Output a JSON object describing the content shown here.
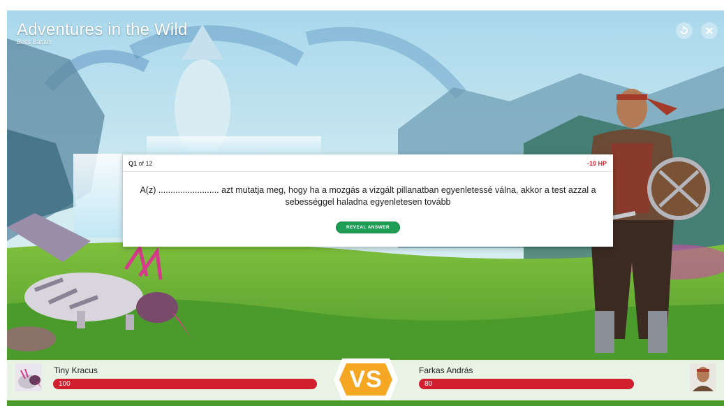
{
  "header": {
    "title": "Adventures in the Wild",
    "subtitle": "Boss Battles"
  },
  "buttons": {
    "restart_icon": "restart-icon",
    "close_icon": "close-icon"
  },
  "question_card": {
    "q_label": "Q1",
    "q_total": "of 12",
    "hp_penalty": "-10 HP",
    "text": "A(z) ......................... azt mutatja meg, hogy ha a mozgás a vizgált pillanatban egyenletessé válna, akkor a test azzal a sebességgel haladna egyenletesen tovább",
    "reveal_label": "REVEAL ANSWER"
  },
  "players": {
    "left": {
      "name": "Tiny Kracus",
      "hp": "100",
      "hp_fraction": 1.0
    },
    "right": {
      "name": "Farkas András",
      "hp": "80",
      "hp_fraction": 0.8
    }
  },
  "vs_label": "VS",
  "colors": {
    "hp_bar": "#d11f2f",
    "reveal_button": "#1e9e54",
    "vs_badge": "#f5a623"
  }
}
